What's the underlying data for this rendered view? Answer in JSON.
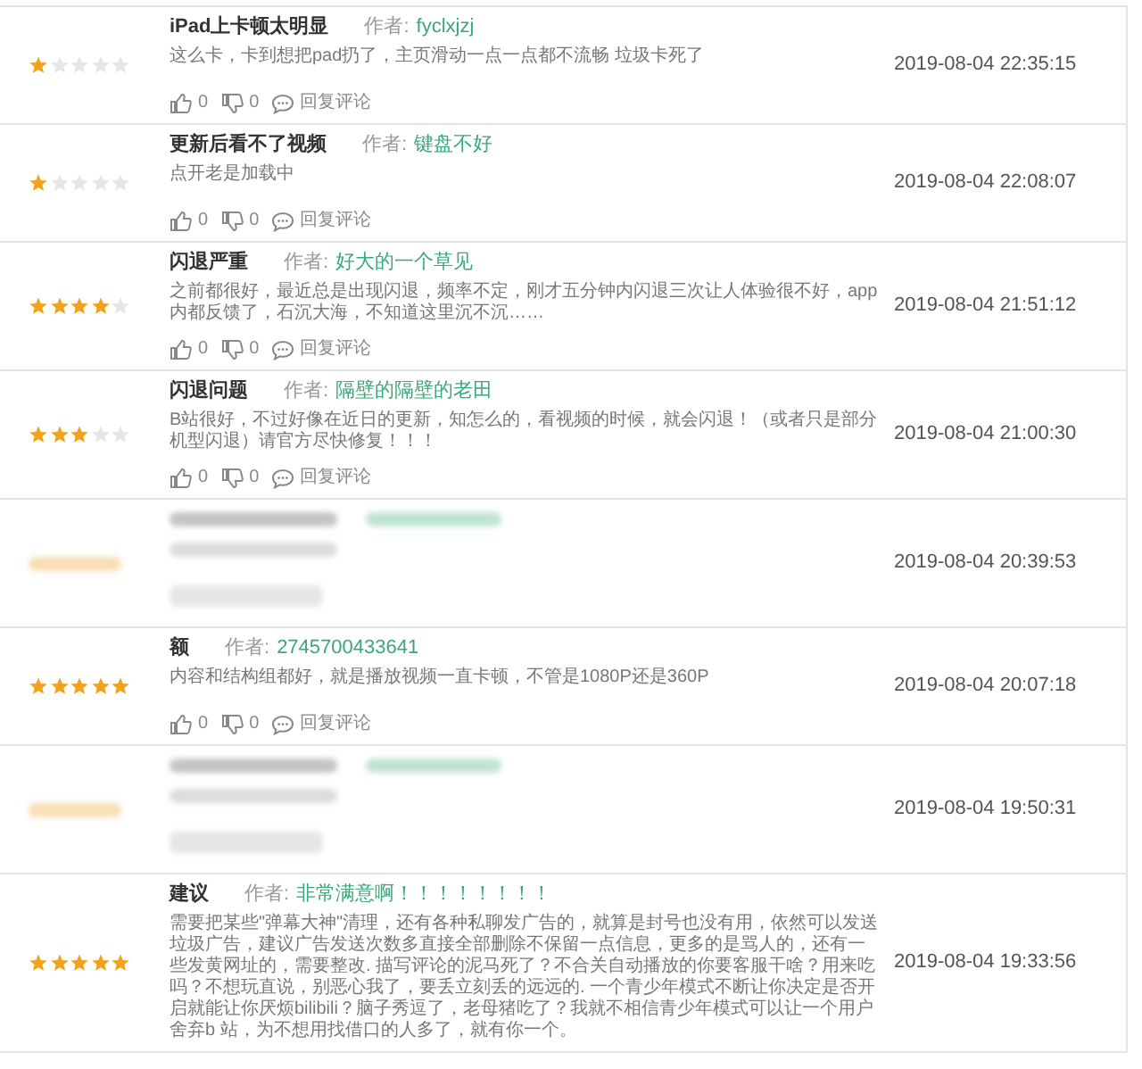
{
  "reviews": [
    {
      "kind": "review",
      "stars": 1,
      "title": "iPad上卡顿太明显",
      "author_label": "作者:",
      "author": "fyclxjzj",
      "body": "这么卡，卡到想把pad扔了，主页滑动一点一点都不流畅 垃圾卡死了",
      "date": "2019-08-04 22:35:15",
      "likes": "0",
      "dislikes": "0",
      "reply": "回复评论"
    },
    {
      "kind": "review",
      "stars": 1,
      "title": "更新后看不了视频",
      "author_label": "作者:",
      "author": "键盘不好",
      "body": "点开老是加载中",
      "date": "2019-08-04 22:08:07",
      "likes": "0",
      "dislikes": "0",
      "reply": "回复评论"
    },
    {
      "kind": "review",
      "stars": 4,
      "title": "闪退严重",
      "author_label": "作者:",
      "author": "好大的一个草见",
      "body": "之前都很好，最近总是出现闪退，频率不定，刚才五分钟内闪退三次让人体验很不好，app内都反馈了，石沉大海，不知道这里沉不沉……",
      "date": "2019-08-04 21:51:12",
      "likes": "0",
      "dislikes": "0",
      "reply": "回复评论"
    },
    {
      "kind": "review",
      "stars": 3,
      "title": "闪退问题",
      "author_label": "作者:",
      "author": "隔壁的隔壁的老田",
      "body": "B站很好，不过好像在近日的更新，知怎么的，看视频的时候，就会闪退！（或者只是部分机型闪退）请官方尽快修复！！！",
      "date": "2019-08-04 21:00:30",
      "likes": "0",
      "dislikes": "0",
      "reply": "回复评论"
    },
    {
      "kind": "redacted",
      "date": "2019-08-04 20:39:53"
    },
    {
      "kind": "review",
      "stars": 5,
      "title": "额",
      "author_label": "作者:",
      "author": "2745700433641",
      "body": "内容和结构组都好，就是播放视频一直卡顿，不管是1080P还是360P",
      "date": "2019-08-04 20:07:18",
      "likes": "0",
      "dislikes": "0",
      "reply": "回复评论"
    },
    {
      "kind": "redacted",
      "date": "2019-08-04 19:50:31"
    },
    {
      "kind": "review",
      "stars": 5,
      "title": "建议",
      "author_label": "作者:",
      "author": "非常满意啊！！！！！！！！",
      "body": "需要把某些\"弹幕大神\"清理，还有各种私聊发广告的，就算是封号也没有用，依然可以发送垃圾广告，建议广告发送次数多直接全部删除不保留一点信息，更多的是骂人的，还有一些发黄网址的，需要整改. 描写评论的泥马死了？不合关自动播放的你要客服干啥？用来吃吗？不想玩直说，别恶心我了，要丢立刻丢的远远的. 一个青少年模式不断让你决定是否开启就能让你厌烦bilibili？脑子秀逗了，老母猪吃了？我就不相信青少年模式可以让一个用户舍弃b 站，为不想用找借口的人多了，就有你一个。",
      "date": "2019-08-04 19:33:56"
    }
  ]
}
